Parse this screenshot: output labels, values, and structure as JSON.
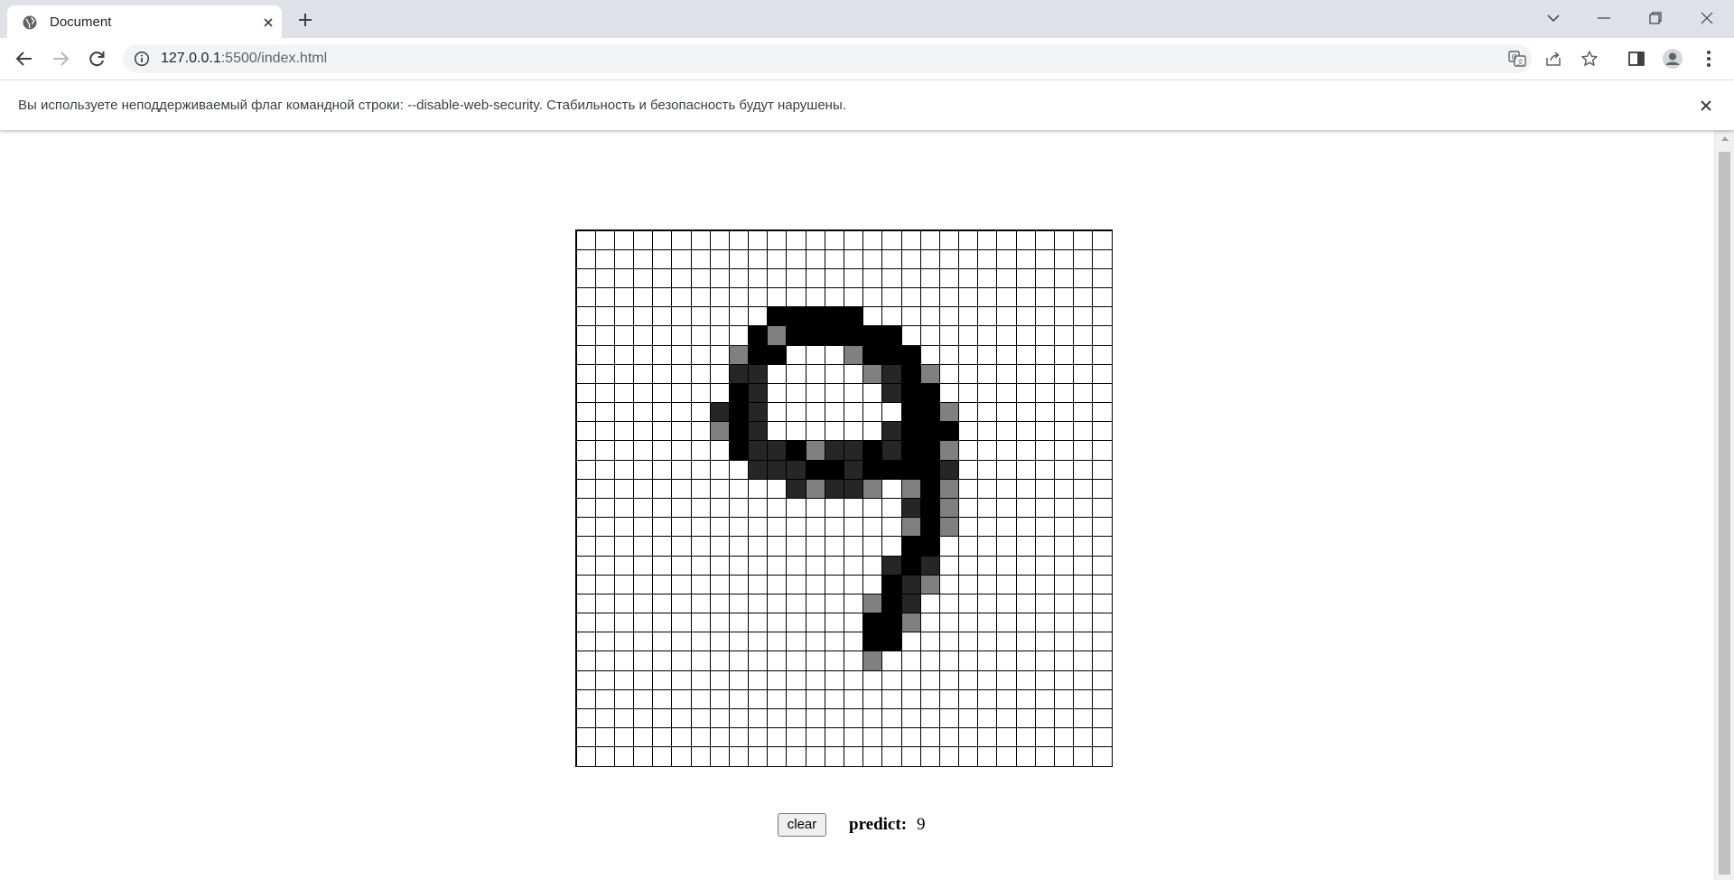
{
  "browser": {
    "tab_title": "Document",
    "url_host": "127.0.0.1",
    "url_rest": ":5500/index.html"
  },
  "infobar": {
    "message": "Вы используете неподдерживаемый флаг командной строки: --disable-web-security. Стабильность и безопасность будут нарушены."
  },
  "page": {
    "clear_label": "clear",
    "predict_label": "predict:",
    "predict_value": "9"
  },
  "canvas": {
    "size": 28,
    "colors": {
      "1": "#000000",
      "2": "#262626",
      "3": "#808080"
    },
    "rows": [
      "0000000000000000000000000000",
      "0000000000000000000000000000",
      "0000000000000000000000000000",
      "0000000000000000000000000000",
      "0000000000111110000000000000",
      "0000000001311111100000000000",
      "0000000031100031110000000000",
      "0000000022000003213000000000",
      "0000000012000000211000000000",
      "0000000212000000011300000000",
      "0000000312000000211100000000",
      "0000000012213221211300000000",
      "0000000002221121111200000000",
      "0000000000023223031300000000",
      "0000000000000000021300000000",
      "0000000000000000031300000000",
      "0000000000000000011000000000",
      "0000000000000000212000000000",
      "0000000000000000123000000000",
      "0000000000000003120000000000",
      "0000000000000001130000000000",
      "0000000000000001100000000000",
      "0000000000000003000000000000",
      "0000000000000000000000000000",
      "0000000000000000000000000000",
      "0000000000000000000000000000",
      "0000000000000000000000000000",
      "0000000000000000000000000000"
    ]
  }
}
